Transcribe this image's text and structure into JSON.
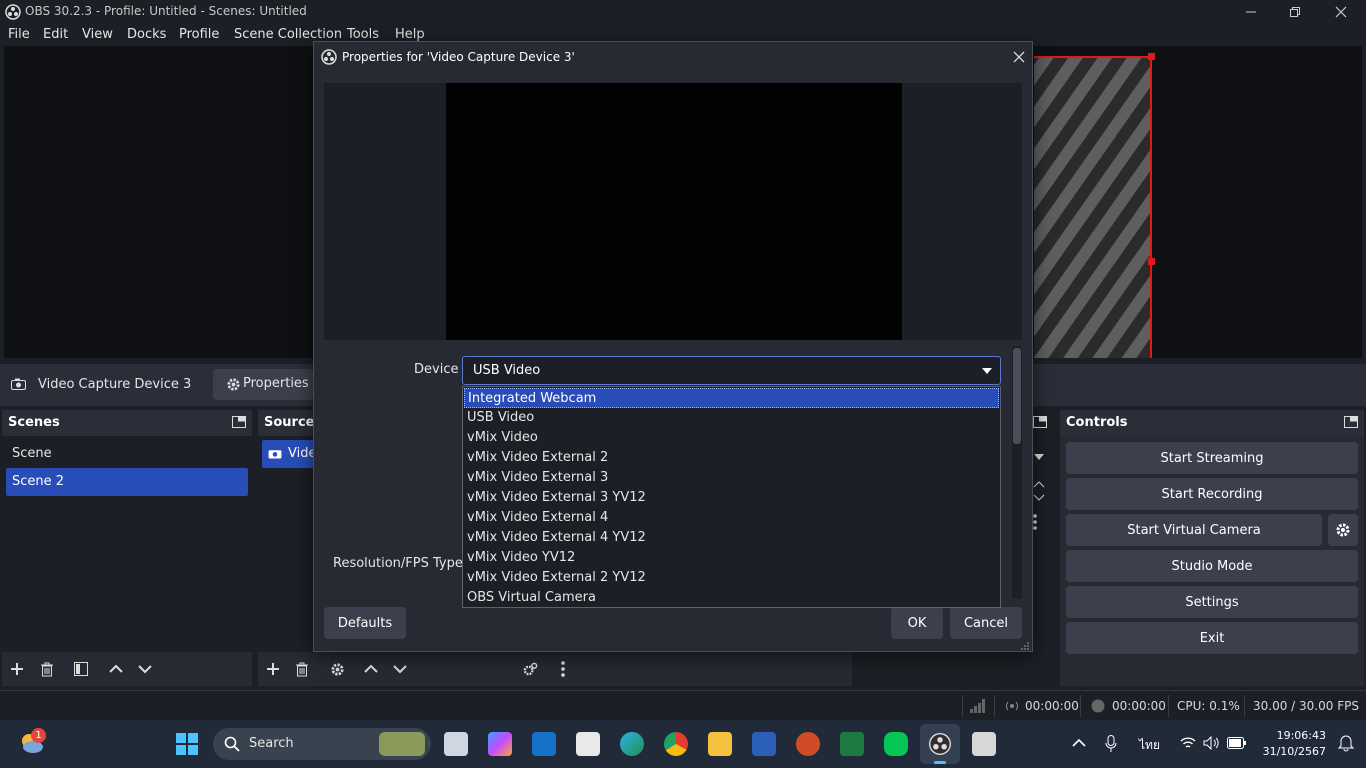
{
  "window": {
    "title": "OBS 30.2.3 - Profile: Untitled - Scenes: Untitled"
  },
  "menu": [
    "File",
    "Edit",
    "View",
    "Docks",
    "Profile",
    "Scene Collection",
    "Tools",
    "Help"
  ],
  "source_toolbar": {
    "source_name": "Video Capture Device 3",
    "properties_label": "Properties"
  },
  "scenes": {
    "title": "Scenes",
    "items": [
      "Scene",
      "Scene 2"
    ],
    "selected": "Scene 2"
  },
  "sources": {
    "title": "Sources",
    "item": "Video"
  },
  "controls": {
    "title": "Controls",
    "start_streaming": "Start Streaming",
    "start_recording": "Start Recording",
    "start_virtual_camera": "Start Virtual Camera",
    "studio_mode": "Studio Mode",
    "settings": "Settings",
    "exit": "Exit"
  },
  "dialog": {
    "title": "Properties for 'Video Capture Device 3'",
    "device_label": "Device",
    "device_value": "USB Video",
    "resolution_label": "Resolution/FPS Type",
    "defaults": "Defaults",
    "ok": "OK",
    "cancel": "Cancel"
  },
  "dropdown": {
    "items": [
      "Integrated Webcam",
      "USB Video",
      "vMix Video",
      "vMix Video External 2",
      "vMix Video External 3",
      "vMix Video External 3 YV12",
      "vMix Video External 4",
      "vMix Video External 4 YV12",
      "vMix Video YV12",
      "vMix Video External 2 YV12",
      "OBS Virtual Camera"
    ],
    "highlighted": "Integrated Webcam"
  },
  "status": {
    "stream_time": "00:00:00",
    "record_time": "00:00:00",
    "cpu": "CPU: 0.1%",
    "fps": "30.00 / 30.00 FPS"
  },
  "taskbar": {
    "search_label": "Search",
    "weather_badge": "1",
    "language": "ไทย",
    "time": "19:06:43",
    "date": "31/10/2567"
  },
  "colors": {
    "selection": "#284cb8",
    "transform_outline": "#e01a1a"
  }
}
